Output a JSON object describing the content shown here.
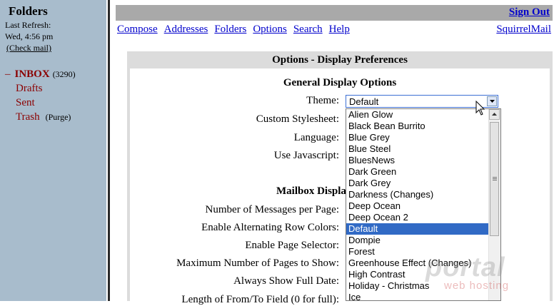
{
  "sidebar": {
    "title": "Folders",
    "last_refresh_label": "Last Refresh:",
    "last_refresh_time": "Wed, 4:56 pm",
    "check_mail": "(Check mail)",
    "inbox_prefix": "–",
    "folders": [
      {
        "name": "INBOX",
        "count": "(3290)"
      },
      {
        "name": "Drafts"
      },
      {
        "name": "Sent"
      },
      {
        "name": "Trash",
        "action": "(Purge)"
      }
    ]
  },
  "header": {
    "sign_out": "Sign Out",
    "nav": [
      "Compose",
      "Addresses",
      "Folders",
      "Options",
      "Search",
      "Help"
    ],
    "brand": "SquirrelMail"
  },
  "panel": {
    "title": "Options - Display Preferences",
    "section_general": "General Display Options",
    "section_mailbox": "Mailbox Displa",
    "labels": {
      "theme": "Theme:",
      "custom_stylesheet": "Custom Stylesheet:",
      "language": "Language:",
      "use_javascript": "Use Javascript:",
      "messages_per_page": "Number of Messages per Page:",
      "alternating_row_colors": "Enable Alternating Row Colors:",
      "page_selector": "Enable Page Selector:",
      "max_pages": "Maximum Number of Pages to Show:",
      "full_date": "Always Show Full Date:",
      "from_to_length": "Length of From/To Field (0 for full):"
    },
    "theme_select": {
      "value": "Default",
      "options": [
        "Alien Glow",
        "Black Bean Burrito",
        "Blue Grey",
        "Blue Steel",
        "BluesNews",
        "Dark Green",
        "Dark Grey",
        "Darkness (Changes)",
        "Deep Ocean",
        "Deep Ocean 2",
        "Default",
        "Dompie",
        "Forest",
        "Greenhouse Effect (Changes)",
        "High Contrast",
        "Holiday - Christmas",
        "Ice"
      ],
      "selected": "Default"
    }
  },
  "watermark": {
    "line1": "portal",
    "line2": "web hosting"
  },
  "colors": {
    "sidebar": "#a8bccc",
    "link": "#0000cc",
    "folder": "#8b0000",
    "selected": "#316ac5"
  }
}
